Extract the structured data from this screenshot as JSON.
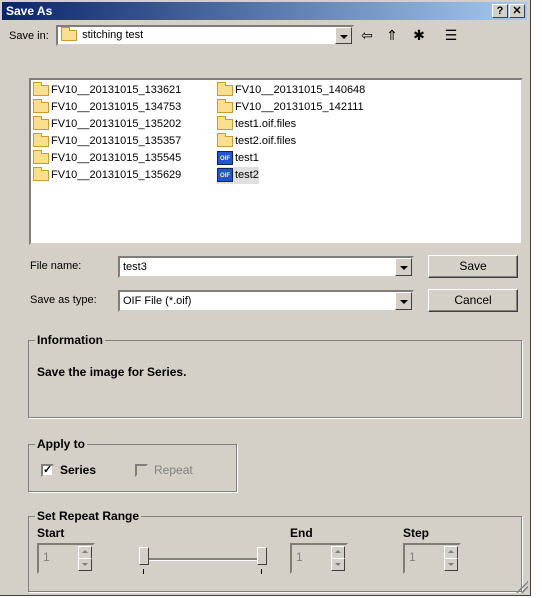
{
  "window": {
    "title": "Save As",
    "help_label": "?",
    "close_label": "✕"
  },
  "toolbar": {
    "save_in_label": "Save in:",
    "location": "stitching test",
    "back_icon": "⇦",
    "up_icon": "⇑",
    "new_folder_icon": "✱",
    "view_menu_icon": "☰"
  },
  "files": {
    "col1": [
      "FV10__20131015_133621",
      "FV10__20131015_134753",
      "FV10__20131015_135202",
      "FV10__20131015_135357",
      "FV10__20131015_135545",
      "FV10__20131015_135629"
    ],
    "col2_folders": [
      "FV10__20131015_140648",
      "FV10__20131015_142111",
      "test1.oif.files",
      "test2.oif.files"
    ],
    "col2_files": [
      "test1",
      "test2"
    ],
    "oif_badge": "OIF"
  },
  "form": {
    "file_name_label": "File name:",
    "file_name_value": "test3",
    "save_as_type_label": "Save as type:",
    "save_as_type_value": "OIF File (*.oif)",
    "save_button": "Save",
    "cancel_button": "Cancel"
  },
  "information": {
    "title": "Information",
    "text": "Save the image for Series."
  },
  "apply_to": {
    "title": "Apply to",
    "series_label": "Series",
    "series_check": "✓",
    "repeat_label": "Repeat"
  },
  "repeat_range": {
    "title": "Set Repeat Range",
    "start_label": "Start",
    "start_value": "1",
    "end_label": "End",
    "end_value": "1",
    "step_label": "Step",
    "step_value": "1"
  }
}
